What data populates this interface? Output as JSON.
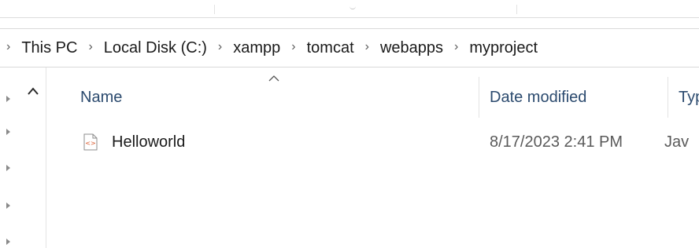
{
  "breadcrumb": {
    "items": [
      "This PC",
      "Local Disk (C:)",
      "xampp",
      "tomcat",
      "webapps",
      "myproject"
    ]
  },
  "columns": {
    "name": "Name",
    "date_modified": "Date modified",
    "type": "Typ"
  },
  "files": [
    {
      "name": "Helloworld",
      "date_modified": "8/17/2023 2:41 PM",
      "type": "Jav",
      "icon": "jsp-file-icon"
    }
  ],
  "colors": {
    "header_text": "#2b4a6e",
    "icon_accent": "#d9582b"
  }
}
